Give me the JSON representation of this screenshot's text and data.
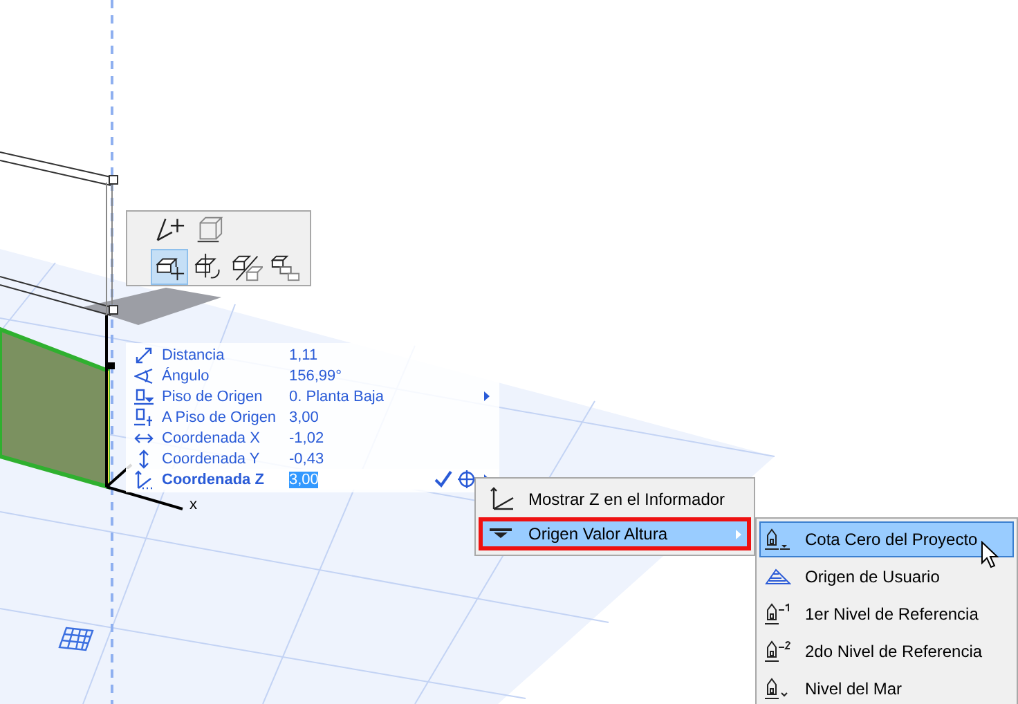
{
  "pet_palette": {
    "rows": [
      [
        {
          "kind": "offset",
          "selected": false
        },
        {
          "kind": "box-frame",
          "selected": false
        }
      ],
      [
        {
          "kind": "drag",
          "selected": true
        },
        {
          "kind": "rotate",
          "selected": false
        },
        {
          "kind": "mirror",
          "selected": false
        },
        {
          "kind": "multiply",
          "selected": false
        }
      ]
    ]
  },
  "tracker": {
    "rows": [
      {
        "kind": "distance",
        "label": "Distancia",
        "value": "1,11",
        "active": false,
        "has_submenu": false
      },
      {
        "kind": "angle",
        "label": "Ángulo",
        "value": "156,99°",
        "active": false,
        "has_submenu": false
      },
      {
        "kind": "story",
        "label": "Piso de Origen",
        "value": "0. Planta Baja",
        "active": false,
        "has_submenu": true
      },
      {
        "kind": "story-offset",
        "label": "A Piso de Origen",
        "value": "3,00",
        "active": false,
        "has_submenu": false
      },
      {
        "kind": "x",
        "label": "Coordenada X",
        "value": "-1,02",
        "active": false,
        "has_submenu": false
      },
      {
        "kind": "y",
        "label": "Coordenada Y",
        "value": "-0,43",
        "active": false,
        "has_submenu": false
      },
      {
        "kind": "z",
        "label": "Coordenada Z",
        "value": "3,00",
        "active": true,
        "has_submenu": true
      }
    ]
  },
  "axis_label": "x",
  "context_menu": {
    "items": [
      {
        "kind": "show-z",
        "label": "Mostrar Z en el Informador",
        "selected": false,
        "outlined": false,
        "has_submenu": false
      },
      {
        "kind": "origin",
        "label": "Origen Valor Altura",
        "selected": true,
        "outlined": true,
        "has_submenu": true
      }
    ]
  },
  "submenu": {
    "items": [
      {
        "kind": "project-zero",
        "label": "Cota Cero del Proyecto",
        "selected": true
      },
      {
        "kind": "user-origin",
        "label": "Origen de Usuario",
        "selected": false
      },
      {
        "kind": "ref1",
        "label": "1er Nivel de Referencia",
        "selected": false
      },
      {
        "kind": "ref2",
        "label": "2do Nivel de Referencia",
        "selected": false
      },
      {
        "kind": "sea",
        "label": "Nivel del Mar",
        "selected": false
      }
    ]
  }
}
